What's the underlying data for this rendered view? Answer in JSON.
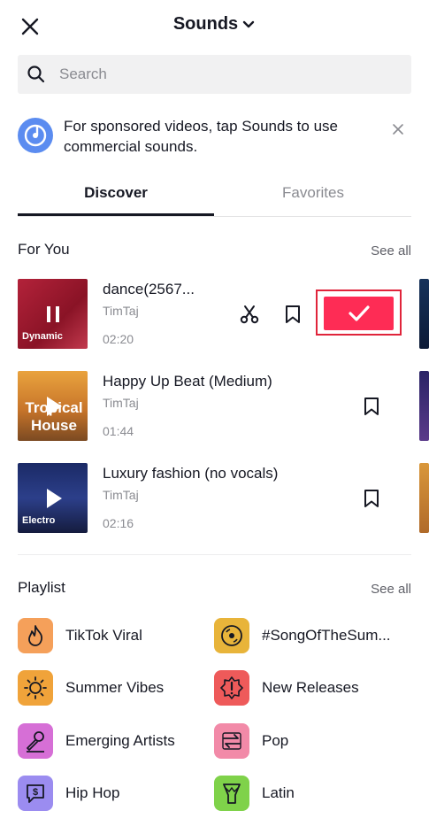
{
  "header": {
    "title": "Sounds"
  },
  "search": {
    "placeholder": "Search",
    "value": ""
  },
  "banner": {
    "text_before": "For sponsored videos, tap ",
    "text_bold": "Sounds",
    "text_after": " to use commercial sounds."
  },
  "tabs": {
    "discover": "Discover",
    "favorites": "Favorites"
  },
  "for_you": {
    "title": "For You",
    "see_all": "See all",
    "tracks": [
      {
        "title": "dance(2567...",
        "artist": "TimTaj",
        "duration": "02:20",
        "cover_label": "Dynamic"
      },
      {
        "title": "Happy Up Beat (Medium)",
        "artist": "TimTaj",
        "duration": "01:44",
        "cover_label": "Tropical House"
      },
      {
        "title": "Luxury fashion (no vocals)",
        "artist": "TimTaj",
        "duration": "02:16",
        "cover_label": "Electro"
      }
    ]
  },
  "playlist": {
    "title": "Playlist",
    "see_all": "See all",
    "items": [
      {
        "label": "TikTok Viral",
        "color": "#f5a05a"
      },
      {
        "label": "#SongOfTheSum...",
        "color": "#e8b43a"
      },
      {
        "label": "Summer Vibes",
        "color": "#f0a33a"
      },
      {
        "label": "New Releases",
        "color": "#ee5a5a"
      },
      {
        "label": "Emerging Artists",
        "color": "#d66fd6"
      },
      {
        "label": "Pop",
        "color": "#f28aa8"
      },
      {
        "label": "Hip Hop",
        "color": "#9b8cf0"
      },
      {
        "label": "Latin",
        "color": "#7fd24a"
      }
    ]
  },
  "colors": {
    "accent": "#fe2c55",
    "text": "#161823",
    "muted": "#8a8b91"
  }
}
